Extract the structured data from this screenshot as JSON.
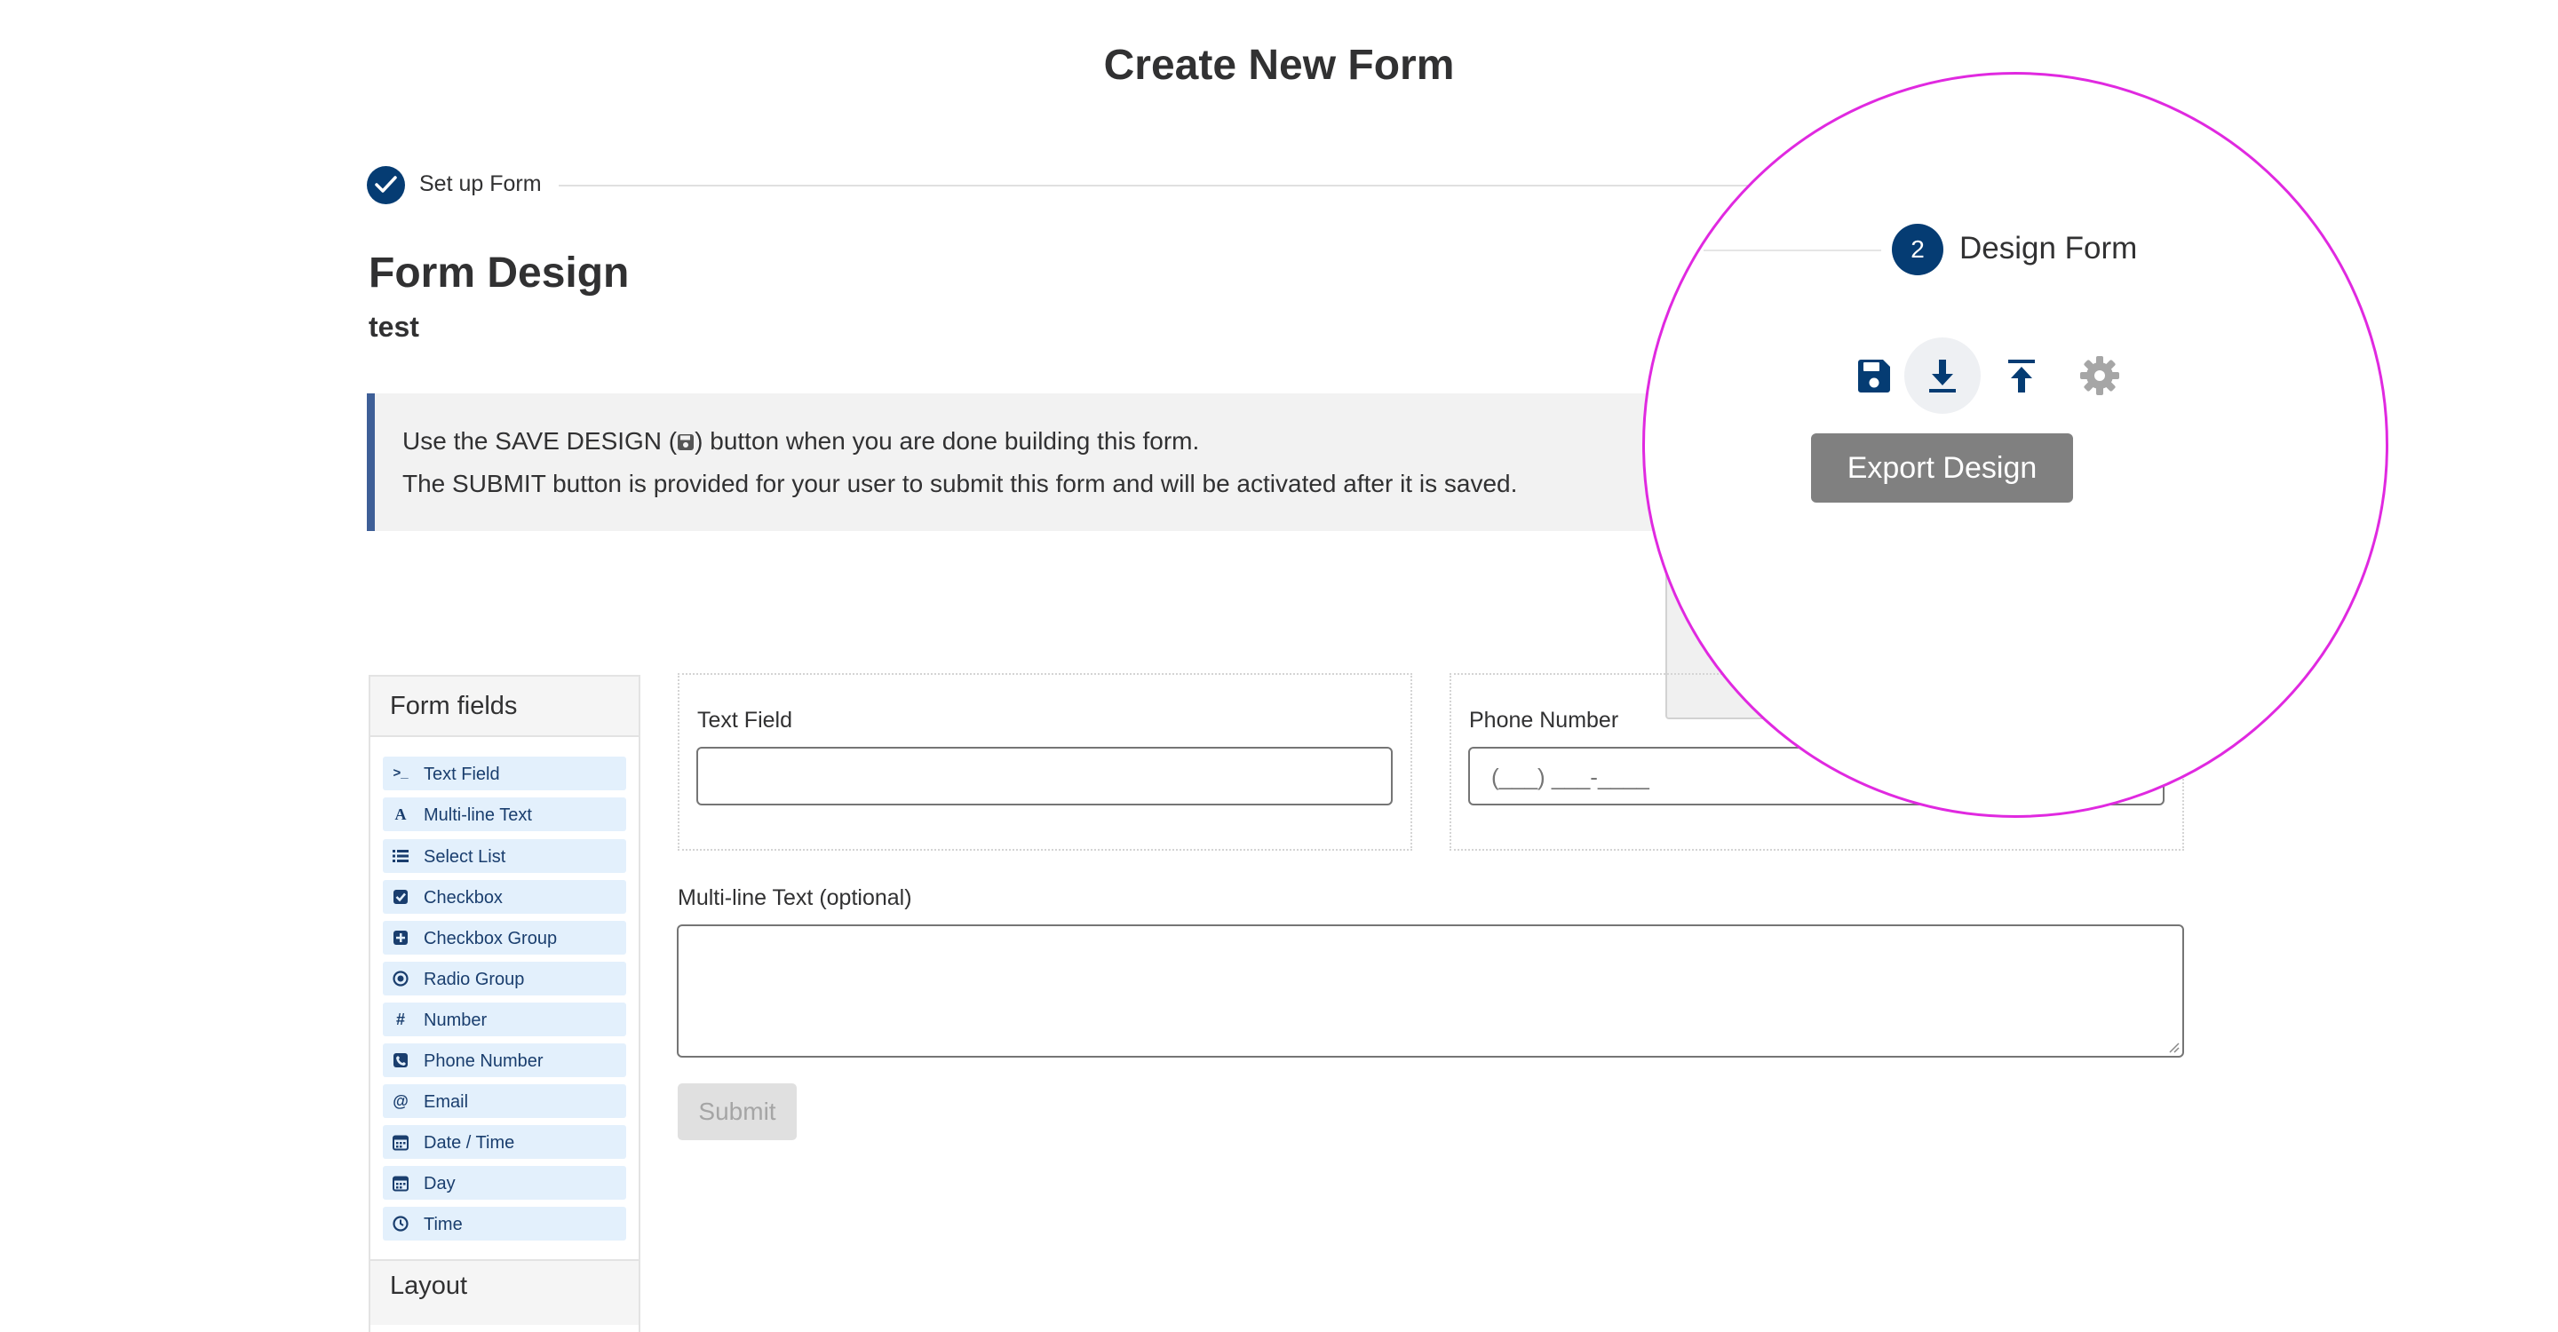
{
  "page_title": "Create New Form",
  "stepper": {
    "step1": {
      "label": "Set up Form"
    },
    "step2": {
      "number": "2",
      "label": "Design Form"
    }
  },
  "heading": "Form Design",
  "form_name": "test",
  "info": {
    "line1_prefix": "Use the SAVE DESIGN (",
    "line1_suffix": ") button when you are done building this form.",
    "line2": "The SUBMIT button is provided for your user to submit this form and will be activated after it is saved."
  },
  "toolbar": {
    "save_icon": "save-icon",
    "export_icon": "download-icon",
    "import_icon": "upload-icon",
    "settings_icon": "gear-icon",
    "tooltip": "Export Design"
  },
  "sidebar": {
    "title": "Form fields",
    "items": [
      {
        "label": "Text Field",
        "icon": "terminal-icon"
      },
      {
        "label": "Multi-line Text",
        "icon": "font-icon"
      },
      {
        "label": "Select List",
        "icon": "list-icon"
      },
      {
        "label": "Checkbox",
        "icon": "check-square-icon"
      },
      {
        "label": "Checkbox Group",
        "icon": "plus-square-icon"
      },
      {
        "label": "Radio Group",
        "icon": "dot-circle-icon"
      },
      {
        "label": "Number",
        "icon": "hash-icon"
      },
      {
        "label": "Phone Number",
        "icon": "phone-square-icon"
      },
      {
        "label": "Email",
        "icon": "at-icon"
      },
      {
        "label": "Date / Time",
        "icon": "calendar-icon"
      },
      {
        "label": "Day",
        "icon": "calendar-icon"
      },
      {
        "label": "Time",
        "icon": "clock-icon"
      }
    ],
    "layout_title": "Layout"
  },
  "canvas": {
    "text_field": {
      "label": "Text Field",
      "value": ""
    },
    "phone_number": {
      "label": "Phone Number",
      "placeholder": "(___) ___-____"
    },
    "multiline": {
      "label": "Multi-line Text (optional)",
      "value": ""
    },
    "submit_label": "Submit"
  },
  "colors": {
    "primary": "#053c73",
    "info_border": "#3e5f97",
    "highlight_circle": "#e029e0",
    "tooltip_bg": "#808080",
    "sidebar_item_bg": "#e3f0fc"
  }
}
